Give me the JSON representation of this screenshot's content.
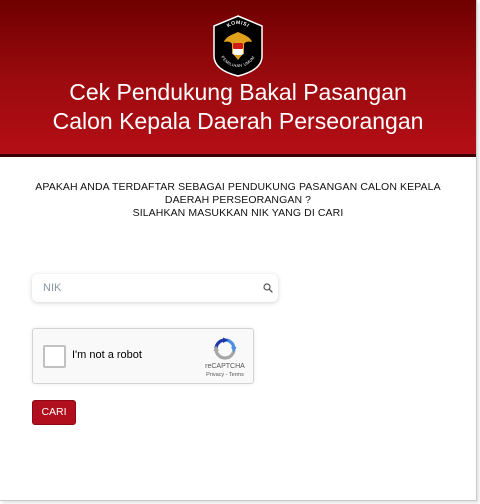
{
  "header": {
    "logo": {
      "top_text": "KOMISI",
      "bottom_text": "PEMILIHAN UMUM",
      "icon": "garuda-emblem-icon"
    },
    "title_line1": "Cek Pendukung Bakal Pasangan",
    "title_line2": "Calon Kepala Daerah Perseorangan"
  },
  "prompt": {
    "line1": "APAKAH ANDA TERDAFTAR SEBAGAI PENDUKUNG PASANGAN CALON KEPALA",
    "line2": "DAERAH PERSEORANGAN ?",
    "line3": "SILAHKAN MASUKKAN NIK YANG DI CARI"
  },
  "search": {
    "placeholder": "NIK",
    "value": "",
    "icon": "search-icon"
  },
  "captcha": {
    "label": "I'm not a robot",
    "brand": "reCAPTCHA",
    "privacy": "Privacy",
    "separator": " - ",
    "terms": "Terms",
    "icon": "recaptcha-logo-icon"
  },
  "submit": {
    "label": "CARI"
  },
  "colors": {
    "header_dark": "#6f0000",
    "header_light": "#b40e16",
    "button": "#b10f1d"
  }
}
